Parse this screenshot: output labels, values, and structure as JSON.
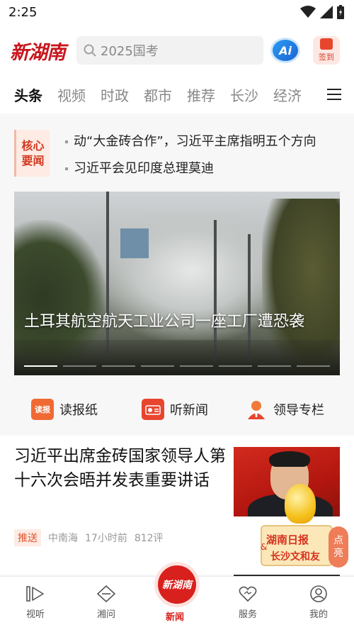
{
  "status_bar": {
    "time": "2:25"
  },
  "header": {
    "logo_text": "新湖南",
    "search_placeholder": "2025国考",
    "ai_label": "Ai",
    "checkin_label": "签到"
  },
  "tabs": [
    {
      "label": "头条",
      "active": true
    },
    {
      "label": "视频",
      "active": false
    },
    {
      "label": "时政",
      "active": false
    },
    {
      "label": "都市",
      "active": false
    },
    {
      "label": "推荐",
      "active": false
    },
    {
      "label": "长沙",
      "active": false
    },
    {
      "label": "经济",
      "active": false
    }
  ],
  "core_news": {
    "badge_line1": "核心",
    "badge_line2": "要闻",
    "items": [
      "动“大金砖合作”，习近平主席指明五个方向",
      "习近平会见印度总理莫迪"
    ]
  },
  "hero": {
    "title": "土耳其航空航天工业公司一座工厂遭恐袭"
  },
  "shortcuts": [
    {
      "label": "读报纸",
      "icon_text": "读报",
      "icon": "newspaper-icon",
      "color": "#f06a33"
    },
    {
      "label": "听新闻",
      "icon_text": "",
      "icon": "radio-icon",
      "color": "#e8452f"
    },
    {
      "label": "领导专栏",
      "icon_text": "",
      "icon": "leader-icon",
      "color": "#e8452f"
    }
  ],
  "article": {
    "title": "习近平出席金砖国家领导人第十六次会晤并发表重要讲话",
    "tag": "推送",
    "source": "中南海",
    "time": "17小时前",
    "comments": "812评"
  },
  "promo": {
    "line1": "湖南日报",
    "amp": "&",
    "line2": "长沙文和友",
    "pill_line1": "点",
    "pill_line2": "亮"
  },
  "bottom_nav": [
    {
      "label": "视听",
      "icon": "play-icon"
    },
    {
      "label": "湘问",
      "icon": "ask-icon"
    },
    {
      "label": "新闻",
      "icon": "news-logo-icon",
      "center_text": "新湖南"
    },
    {
      "label": "服务",
      "icon": "heart-service-icon"
    },
    {
      "label": "我的",
      "icon": "profile-icon"
    }
  ],
  "colors": {
    "brand_red": "#c8161d",
    "accent_orange": "#e0542e",
    "ai_blue": "#1b64d6"
  }
}
